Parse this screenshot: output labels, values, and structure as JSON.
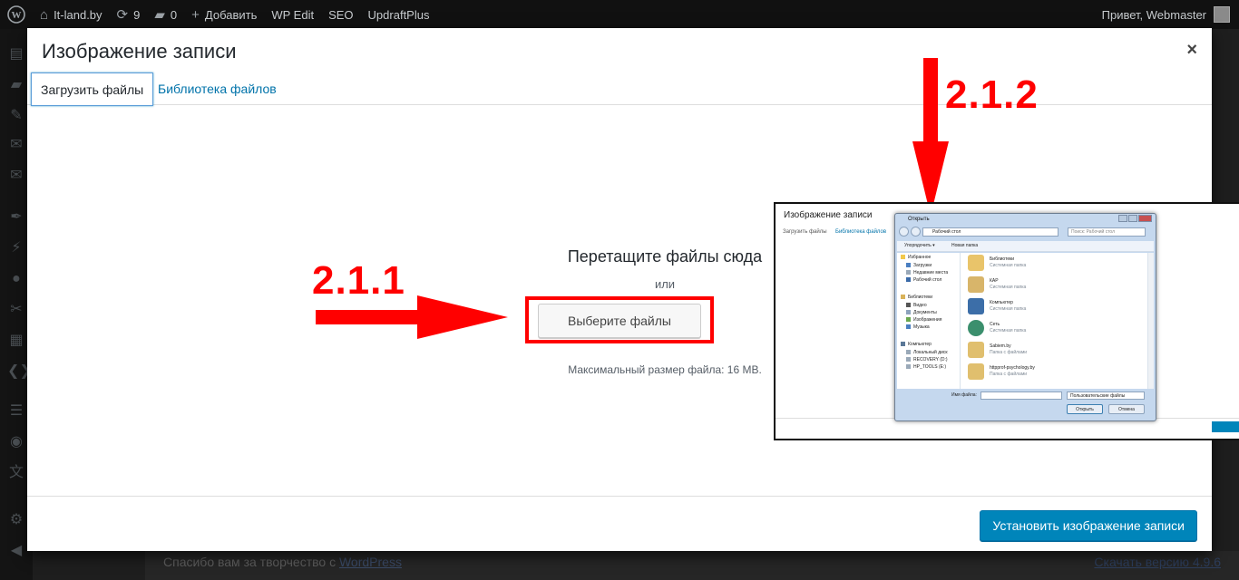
{
  "admin_bar": {
    "site_name": "It-land.by",
    "updates_count": "9",
    "comments_count": "0",
    "add_new": "Добавить",
    "wp_edit": "WP Edit",
    "seo": "SEO",
    "updraft": "UpdraftPlus",
    "greeting": "Привет, Webmaster"
  },
  "modal": {
    "title": "Изображение записи",
    "close_symbol": "×",
    "tabs": [
      {
        "label": "Загрузить файлы"
      },
      {
        "label": "Библиотека файлов"
      }
    ],
    "uploader": {
      "drop_title": "Перетащите файлы сюда",
      "or": "или",
      "select_button": "Выберите файлы",
      "max_size": "Максимальный размер файла: 16 MB."
    },
    "set_image_button": "Установить изображение записи"
  },
  "footer": {
    "thanks_prefix": "Спасибо вам за творчество с ",
    "thanks_link": "WordPress",
    "version_link": "Скачать версию 4.9.6"
  },
  "annotations": {
    "step_1": "2.1.1",
    "step_2": "2.1.2"
  },
  "inset": {
    "title": "Изображение записи",
    "tab_upload": "Загрузить файлы",
    "tab_library": "Библиотека файлов",
    "dialog": {
      "title": "Открыть",
      "address": "Рабочий стол",
      "search_placeholder": "Поиск: Рабочий стол",
      "organize": "Упорядочить ▾",
      "new_folder": "Новая папка",
      "nav": [
        {
          "label": "Избранное"
        },
        {
          "label": "Загрузки"
        },
        {
          "label": "Недавние места"
        },
        {
          "label": "Рабочий стол"
        },
        {
          "label": "Библиотеки"
        },
        {
          "label": "Видео"
        },
        {
          "label": "Документы"
        },
        {
          "label": "Изображения"
        },
        {
          "label": "Музыка"
        },
        {
          "label": "Компьютер"
        },
        {
          "label": "Локальный диск"
        },
        {
          "label": "RECOVERY (D:)"
        },
        {
          "label": "HP_TOOLS (E:)"
        }
      ],
      "files": [
        {
          "name": "Библиотеки",
          "sub": "Системная папка"
        },
        {
          "name": "КАР",
          "sub": "Системная папка"
        },
        {
          "name": "Компьютер",
          "sub": "Системная папка"
        },
        {
          "name": "Сеть",
          "sub": "Системная папка"
        },
        {
          "name": "Sabiem.by",
          "sub": "Папка с файлами"
        },
        {
          "name": "httpprof-psychology.by",
          "sub": "Папка с файлами"
        }
      ],
      "filename_label": "Имя файла:",
      "filetype": "Пользовательские файлы",
      "open_button": "Открыть",
      "cancel_button": "Отмена"
    }
  },
  "colors": {
    "annotation_red": "#ff0000",
    "wp_primary": "#0085ba",
    "link_blue": "#0073aa"
  }
}
